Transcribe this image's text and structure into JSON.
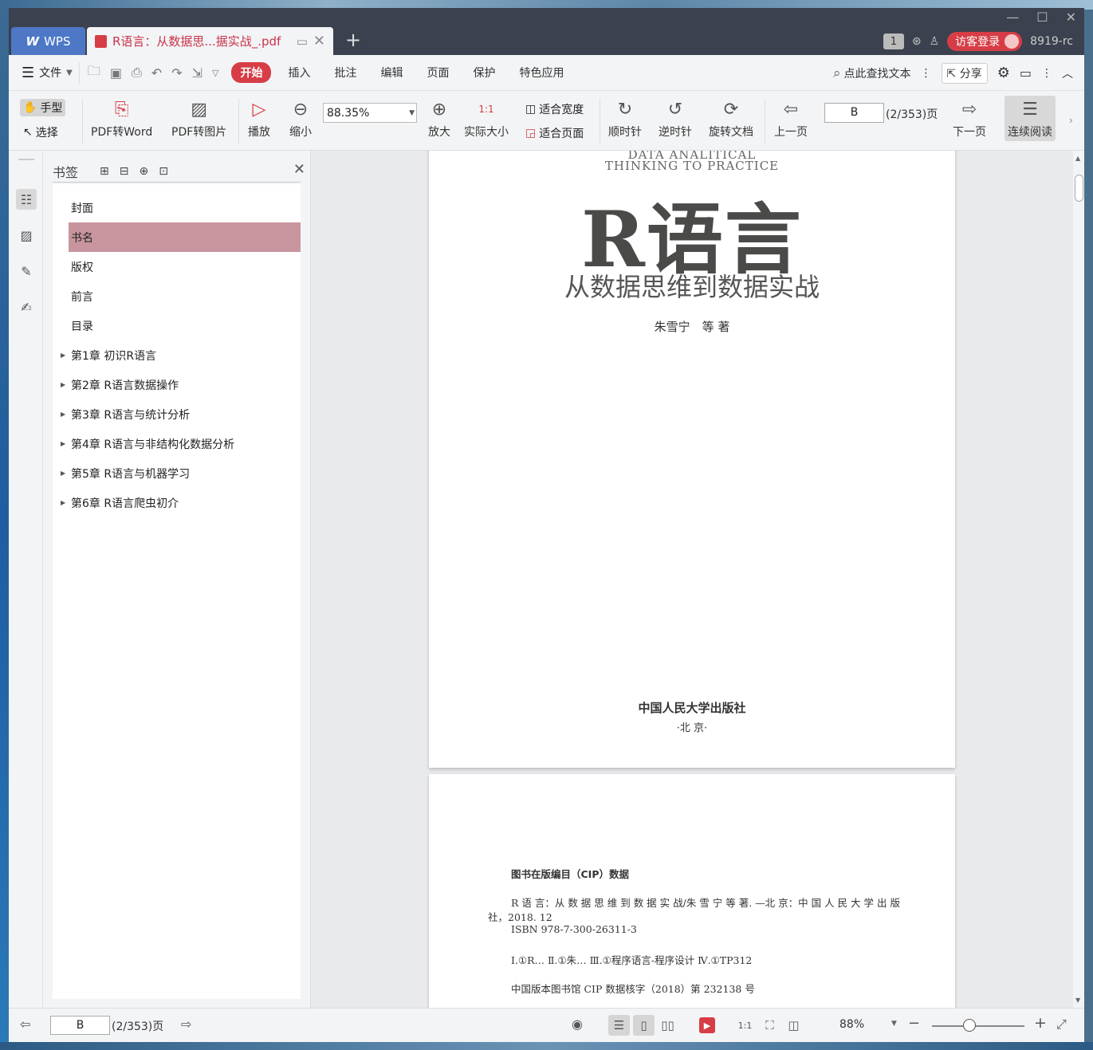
{
  "titlebar": {
    "app_tab": "WPS",
    "doc_tab": "R语言：从数据思...据实战_.pdf",
    "page_badge": "1",
    "login_label": "访客登录",
    "user_label": "8919-rc"
  },
  "menubar": {
    "file_label": "文件",
    "items": [
      "开始",
      "插入",
      "批注",
      "编辑",
      "页面",
      "保护",
      "特色应用"
    ],
    "search_label": "点此查找文本",
    "share_label": "分享"
  },
  "toolbar": {
    "hand": "手型",
    "select": "选择",
    "pdf_to_word": "PDF转Word",
    "pdf_to_image": "PDF转图片",
    "play": "播放",
    "zoom_out": "缩小",
    "zoom_value": "88.35%",
    "zoom_in": "放大",
    "actual_size": "实际大小",
    "fit_width": "适合宽度",
    "fit_page": "适合页面",
    "clockwise": "顺时针",
    "counterclockwise": "逆时针",
    "rotate_doc": "旋转文档",
    "prev_page": "上一页",
    "page_input": "B",
    "page_total": "(2/353)页",
    "next_page": "下一页",
    "continuous": "连续阅读"
  },
  "bookmarks": {
    "title": "书签",
    "items": [
      "封面",
      "书名",
      "版权",
      "前言",
      "目录",
      "第1章  初识R语言",
      "第2章  R语言数据操作",
      "第3章  R语言与统计分析",
      "第4章  R语言与非结构化数据分析",
      "第5章  R语言与机器学习",
      "第6章  R语言爬虫初介"
    ]
  },
  "page1": {
    "en_line1": "DATA ANALITICAL",
    "en_line2": "THINKING TO PRACTICE",
    "title": "R语言",
    "subtitle": "从数据思维到数据实战",
    "author": "朱雪宁　等 著",
    "publisher": "中国人民大学出版社",
    "city": "·北 京·"
  },
  "page2": {
    "cip_heading": "图书在版编目（CIP）数据",
    "line1": "R 语 言：从 数 据 思 维 到 数 据 实 战/朱 雪 宁 等 著. —北 京：中 国 人 民 大 学 出 版",
    "line2": "社，2018. 12",
    "line3": "ISBN 978-7-300-26311-3",
    "line4": "Ⅰ.①R…  Ⅱ.①朱…  Ⅲ.①程序语言-程序设计  Ⅳ.①TP312",
    "line5": "中国版本图书馆 CIP 数据核字（2018）第 232138 号"
  },
  "statusbar": {
    "page_input": "B",
    "page_total": "(2/353)页",
    "zoom": "88%"
  }
}
